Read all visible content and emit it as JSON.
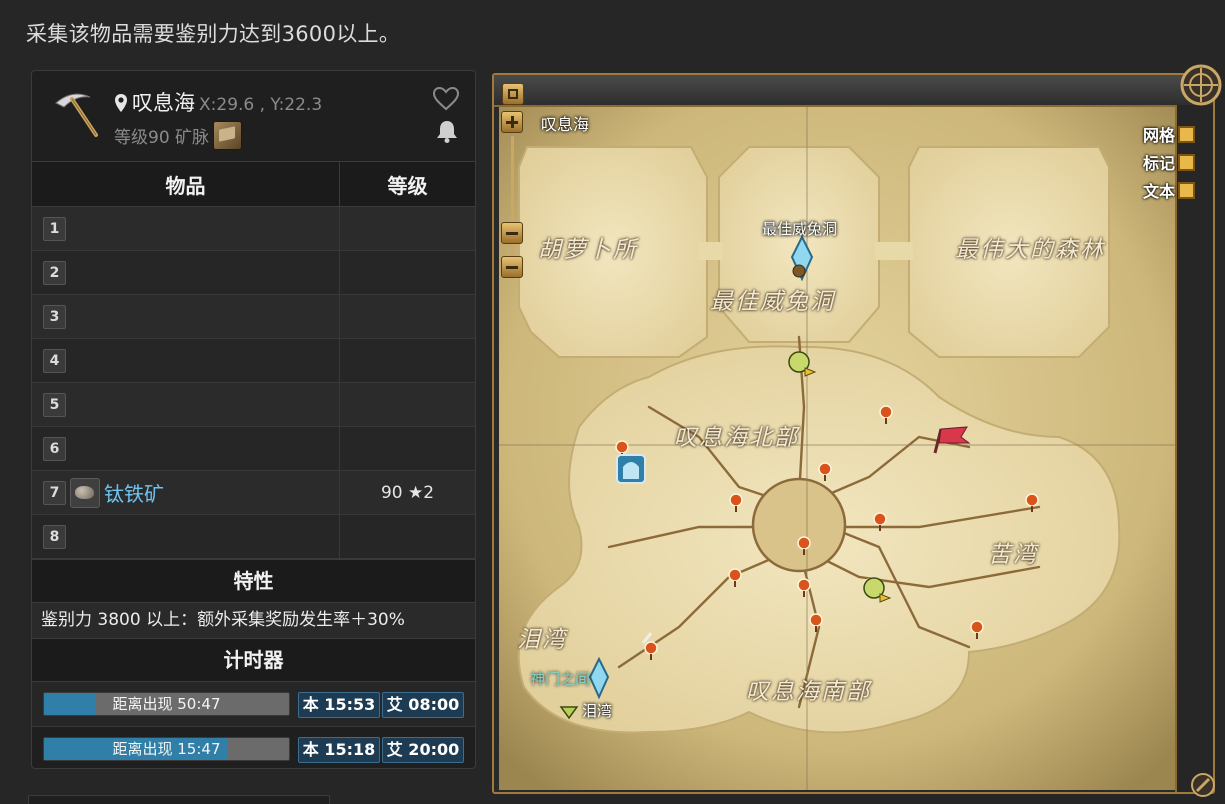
{
  "notice": "采集该物品需要鉴别力达到3600以上。",
  "node": {
    "zone": "叹息海",
    "coords": "X:29.6 , Y:22.3",
    "level_text": "等级90 矿脉"
  },
  "table": {
    "col_item": "物品",
    "col_level": "等级",
    "rows": [
      {
        "slot": "1",
        "name": "",
        "level": ""
      },
      {
        "slot": "2",
        "name": "",
        "level": ""
      },
      {
        "slot": "3",
        "name": "",
        "level": ""
      },
      {
        "slot": "4",
        "name": "",
        "level": ""
      },
      {
        "slot": "5",
        "name": "",
        "level": ""
      },
      {
        "slot": "6",
        "name": "",
        "level": ""
      },
      {
        "slot": "7",
        "name": "钛铁矿",
        "level": "90 ★2",
        "icon": "ore-icon"
      },
      {
        "slot": "8",
        "name": "",
        "level": ""
      }
    ]
  },
  "traits": {
    "heading": "特性",
    "text": "鉴别力 3800 以上：额外采集奖励发生率＋30%"
  },
  "timers": {
    "heading": "计时器",
    "rows": [
      {
        "label": "距离出现 50:47",
        "progress": 0.21,
        "local": "本 15:53",
        "eorzea": "艾 08:00"
      },
      {
        "label": "距离出现 15:47",
        "progress": 0.75,
        "local": "本 15:18",
        "eorzea": "艾 20:00"
      }
    ]
  },
  "map": {
    "zone_label": "叹息海",
    "legend": {
      "grid": "网格",
      "marker": "标记",
      "text": "文本"
    },
    "places": {
      "carrot": "胡萝卜所",
      "forest": "最伟大的森林",
      "burrow": "最佳威兔洞",
      "burrow_aetheryte": "最佳威兔洞",
      "north": "叹息海北部",
      "south": "叹息海南部",
      "bitter_bay": "苦湾",
      "tear_bay": "泪湾",
      "gate_aetheryte": "神门之间",
      "tear_bay_label": "泪湾"
    },
    "accent": "#a07a3a",
    "parchment": "#d8c48e"
  }
}
